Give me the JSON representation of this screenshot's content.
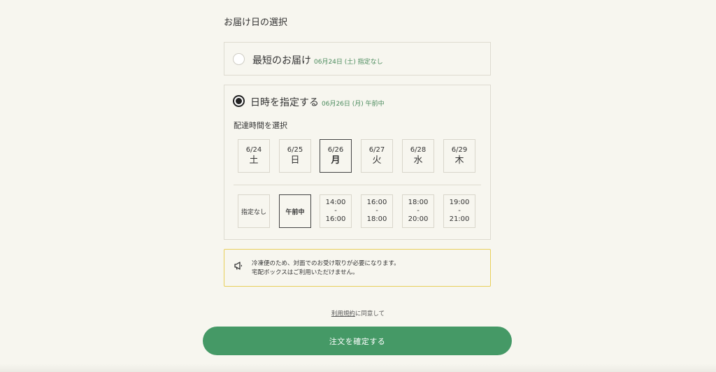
{
  "section_title": "お届け日の選択",
  "fastest": {
    "label": "最短のお届け",
    "sub": "06月24日 (土) 指定なし"
  },
  "specify": {
    "label": "日時を指定する",
    "sub": "06月26日 (月) 午前中"
  },
  "delivery_time_title": "配達時間を選択",
  "dates": [
    {
      "date": "6/24",
      "day": "土",
      "selected": false
    },
    {
      "date": "6/25",
      "day": "日",
      "selected": false
    },
    {
      "date": "6/26",
      "day": "月",
      "selected": true
    },
    {
      "date": "6/27",
      "day": "火",
      "selected": false
    },
    {
      "date": "6/28",
      "day": "水",
      "selected": false
    },
    {
      "date": "6/29",
      "day": "木",
      "selected": false
    }
  ],
  "times": [
    {
      "label": "指定なし",
      "selected": false
    },
    {
      "label": "午前中",
      "selected": true
    },
    {
      "start": "14:00",
      "sep": "-",
      "end": "16:00",
      "selected": false
    },
    {
      "start": "16:00",
      "sep": "-",
      "end": "18:00",
      "selected": false
    },
    {
      "start": "18:00",
      "sep": "-",
      "end": "20:00",
      "selected": false
    },
    {
      "start": "19:00",
      "sep": "-",
      "end": "21:00",
      "selected": false
    }
  ],
  "notice": {
    "icon": "megaphone-icon",
    "line1": "冷凍便のため、対面でのお受け取りが必要になります。",
    "line2": "宅配ボックスはご利用いただけません。"
  },
  "terms": {
    "link": "利用規約",
    "suffix": "に同意して"
  },
  "submit_label": "注文を確定する",
  "colors": {
    "accent": "#459966",
    "sub_text": "#4a8a5c",
    "notice_border": "#e8cf5a",
    "background": "#f7f6ef"
  }
}
